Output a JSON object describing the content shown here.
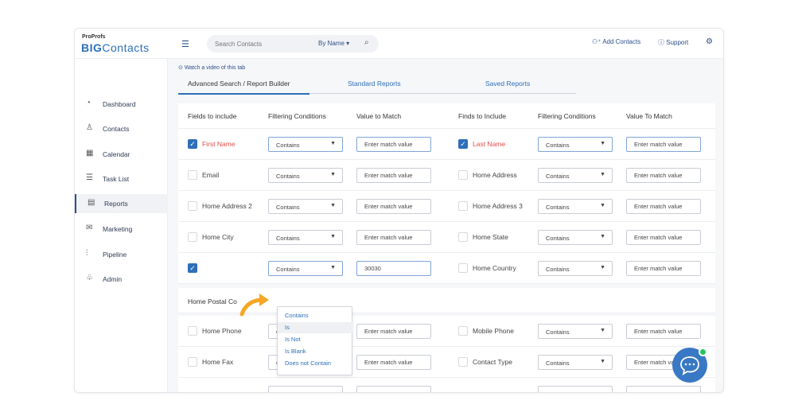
{
  "brand": {
    "small": "ProProfs",
    "big_bold": "BIG",
    "big_light": "Contacts"
  },
  "search": {
    "placeholder": "Search Contacts",
    "by_label": "By Name ▾"
  },
  "topbar": {
    "add_contacts": "Add Contacts",
    "support": "Support"
  },
  "sidebar": {
    "items": [
      {
        "label": "Dashboard",
        "icon": "dashboard-icon"
      },
      {
        "label": "Contacts",
        "icon": "user-icon"
      },
      {
        "label": "Calendar",
        "icon": "calendar-icon"
      },
      {
        "label": "Task List",
        "icon": "task-list-icon"
      },
      {
        "label": "Reports",
        "icon": "report-icon"
      },
      {
        "label": "Marketing",
        "icon": "mail-icon"
      },
      {
        "label": "Pipeline",
        "icon": "pipeline-icon"
      },
      {
        "label": "Admin",
        "icon": "admin-icon"
      }
    ]
  },
  "video_link": "Watch a video of this tab",
  "tabs": [
    "Advanced Search / Report Builder",
    "Standard Reports",
    "Saved Reports"
  ],
  "headers": [
    "Fields to include",
    "Filtering Conditions",
    "Value to Match",
    "Finds to Include",
    "Filtering Conditions",
    "Value To Match"
  ],
  "condition_default": "Contains",
  "match_placeholder": "Enter match value",
  "rows": [
    {
      "left": "First Name",
      "right": "Last Name"
    },
    {
      "left": "Email",
      "right": "Home Address"
    },
    {
      "left": "Home Address 2",
      "right": "Home Address 3"
    },
    {
      "left": "Home City",
      "right": "Home State"
    },
    {
      "left": "",
      "left_value": "30030",
      "right": "Home Country"
    },
    {
      "left": "Home Phone",
      "right": "Mobile Phone"
    },
    {
      "left": "Home Fax",
      "right": "Contact Type"
    }
  ],
  "section_label": "Home Postal Co",
  "dropdown_options": [
    "Contains",
    "Is",
    "Is Not",
    "Is Blank",
    "Does not Contain"
  ],
  "colors": {
    "accent": "#2d6fb8",
    "required": "#e0504a",
    "arrow": "#f5a623",
    "chat": "#3978c4"
  }
}
